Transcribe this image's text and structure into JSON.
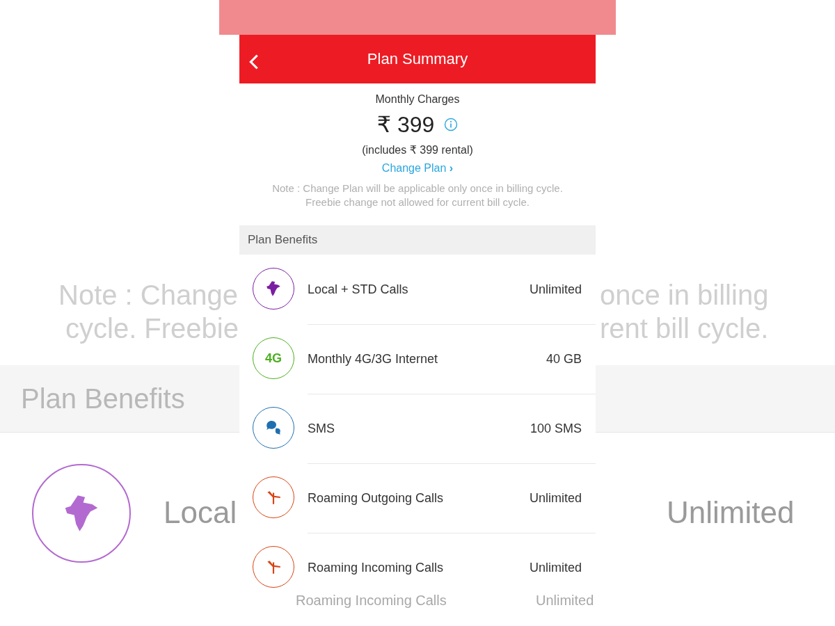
{
  "backdrop": {
    "note_fragments": [
      {
        "left": "Note : Change",
        "right": "once in billing"
      },
      {
        "left": "cycle. Freebie",
        "right": "rent bill cycle."
      }
    ],
    "section_title": "Plan Benefits",
    "row": {
      "kind": "india",
      "color": "#b36ad0",
      "label": "Local",
      "value": "Unlimited"
    },
    "bottom_row": {
      "label": "Roaming Incoming Calls",
      "value": "Unlimited"
    }
  },
  "header": {
    "title": "Plan Summary"
  },
  "charges": {
    "label": "Monthly Charges",
    "amount": "₹ 399",
    "includes": "(includes ₹ 399 rental)",
    "change_link": "Change Plan",
    "change_arrow": "›",
    "note": "Note : Change Plan will be applicable only once in billing cycle. Freebie change not allowed for current bill cycle."
  },
  "benefits": {
    "title": "Plan Benefits",
    "items": [
      {
        "kind": "india",
        "color": "#7b1fa2",
        "label": "Local + STD Calls",
        "value": "Unlimited"
      },
      {
        "kind": "text",
        "icon_text": "4G",
        "color": "#4caf1f",
        "label": "Monthly 4G/3G Internet",
        "value": "40 GB"
      },
      {
        "kind": "sms",
        "color": "#1f6fb0",
        "label": "SMS",
        "value": "100 SMS"
      },
      {
        "kind": "roaming",
        "color": "#d84315",
        "label": "Roaming Outgoing Calls",
        "value": "Unlimited"
      },
      {
        "kind": "roaming",
        "color": "#d84315",
        "label": "Roaming Incoming Calls",
        "value": "Unlimited"
      }
    ]
  }
}
